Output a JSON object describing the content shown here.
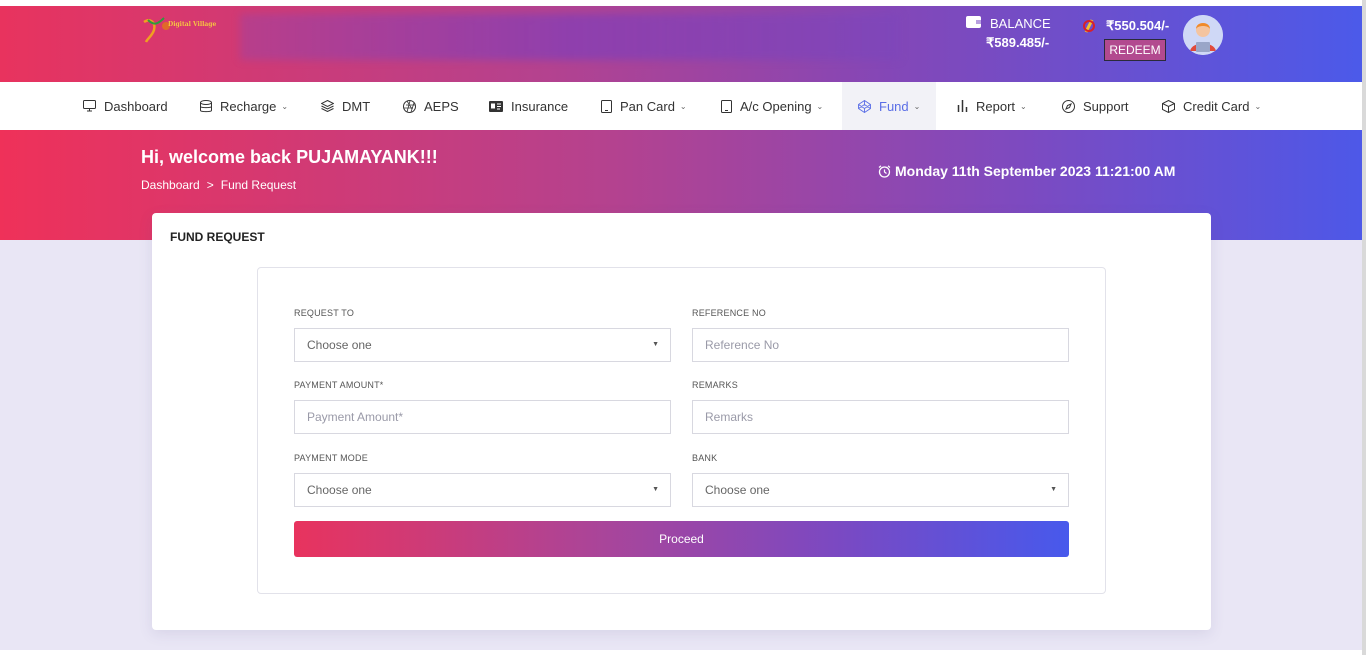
{
  "header": {
    "logo_text": "Digital Village",
    "balance_label": "BALANCE",
    "balance_value": "₹589.485/-",
    "reward_value": "₹550.504/-",
    "redeem_label": "REDEEM"
  },
  "nav": {
    "items": [
      {
        "label": "Dashboard",
        "icon": "monitor-icon"
      },
      {
        "label": "Recharge",
        "icon": "database-icon"
      },
      {
        "label": "DMT",
        "icon": "layers-icon"
      },
      {
        "label": "AEPS",
        "icon": "aperture-icon"
      },
      {
        "label": "Insurance",
        "icon": "id-card-icon"
      },
      {
        "label": "Pan Card",
        "icon": "tablet-icon"
      },
      {
        "label": "A/c Opening",
        "icon": "tablet-icon"
      },
      {
        "label": "Fund",
        "icon": "codepen-icon"
      },
      {
        "label": "Report",
        "icon": "bar-chart-icon"
      },
      {
        "label": "Support",
        "icon": "compass-icon"
      },
      {
        "label": "Credit Card",
        "icon": "box-icon"
      }
    ],
    "active": "Fund"
  },
  "hero": {
    "welcome": "Hi, welcome back PUJAMAYANK!!!",
    "breadcrumb_home": "Dashboard",
    "breadcrumb_sep": ">",
    "breadcrumb_current": "Fund Request",
    "datetime": "Monday 11th September 2023 11:21:00 AM"
  },
  "form": {
    "title": "FUND REQUEST",
    "request_to_label": "REQUEST TO",
    "request_to_value": "Choose one",
    "reference_label": "REFERENCE NO",
    "reference_placeholder": "Reference No",
    "amount_label": "PAYMENT AMOUNT*",
    "amount_placeholder": "Payment Amount*",
    "remarks_label": "REMARKS",
    "remarks_placeholder": "Remarks",
    "mode_label": "PAYMENT MODE",
    "mode_value": "Choose one",
    "bank_label": "BANK",
    "bank_value": "Choose one",
    "proceed_label": "Proceed"
  },
  "colors": {
    "gradient_start": "#e8335e",
    "gradient_end": "#4b5aea",
    "active_nav": "#5a6ee6"
  }
}
